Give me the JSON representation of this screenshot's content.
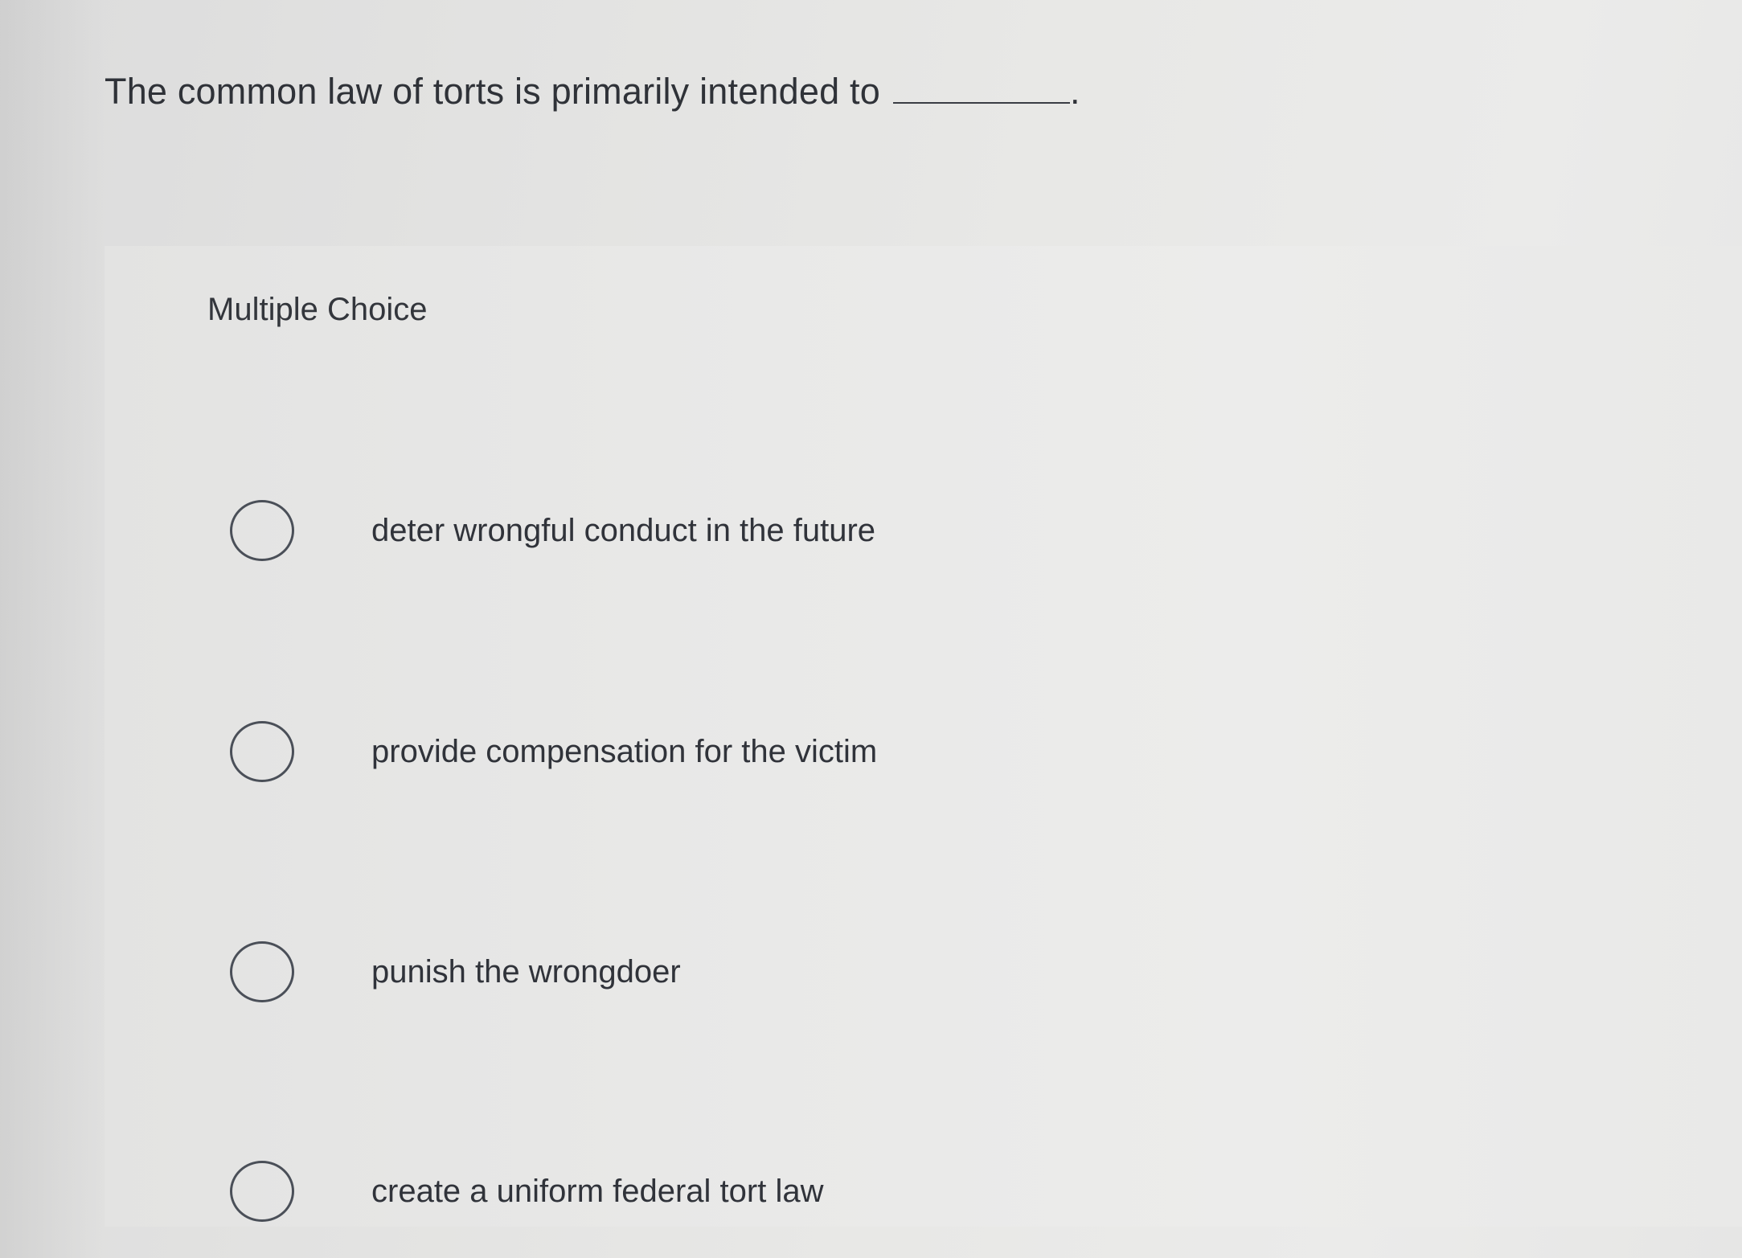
{
  "question": {
    "prefix": "The common law of torts is primarily intended to",
    "suffix": "."
  },
  "multiple_choice_label": "Multiple Choice",
  "options": [
    {
      "label": "deter wrongful conduct in the future",
      "selected": false
    },
    {
      "label": "provide compensation for the victim",
      "selected": false
    },
    {
      "label": "punish the wrongdoer",
      "selected": false
    },
    {
      "label": "create a uniform federal tort law",
      "selected": false
    }
  ],
  "icons": {
    "radio": "radio-button-unselected-icon"
  },
  "colors": {
    "text": "#30333a",
    "radio_border": "#4a4f58",
    "background": "#e6e6e5"
  }
}
